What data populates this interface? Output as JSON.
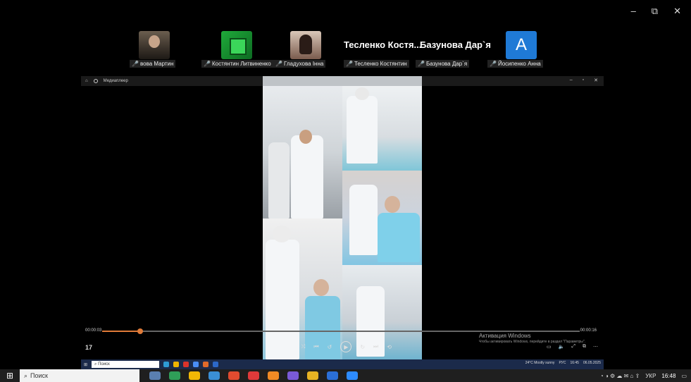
{
  "window": {
    "minimize": "–",
    "restore": "⧉",
    "close": "✕"
  },
  "participants": [
    {
      "label": "вова Мартин",
      "tile": "photo1"
    },
    {
      "label": "Костянтин Литвиненко",
      "tile": "photo2"
    },
    {
      "label": "Гладухова Інна",
      "tile": "photo3"
    },
    {
      "big": "Тесленко  Костя...",
      "label": "Тесленко Костянтин"
    },
    {
      "big": "Базунова Дар`я",
      "label": "Базунова Дар`я"
    },
    {
      "label": "Йосипенко Анна",
      "tile": "letter",
      "letter": "A"
    }
  ],
  "player": {
    "title": "Медиаплеер",
    "time_left": "00:00:03",
    "time_right": "00:00:16",
    "progress": 0.08,
    "counter": "17",
    "activation_title": "Активация Windows",
    "activation_sub": "Чтобы активировать Windows, перейдите в раздел \"Параметры\"."
  },
  "inner_taskbar": {
    "search": "Поиск",
    "weather": "24°C  Mostly sunny",
    "lang": "РУС",
    "time": "16:45",
    "date": "06.05.2025"
  },
  "taskbar": {
    "search": "Поиск",
    "lang": "УКР",
    "time": "16:48"
  },
  "colors": {
    "accent": "#e07b39",
    "taskbar": "#1f1f1f",
    "inner_taskbar": "#1b2a4a",
    "mute": "#e23b3b"
  }
}
